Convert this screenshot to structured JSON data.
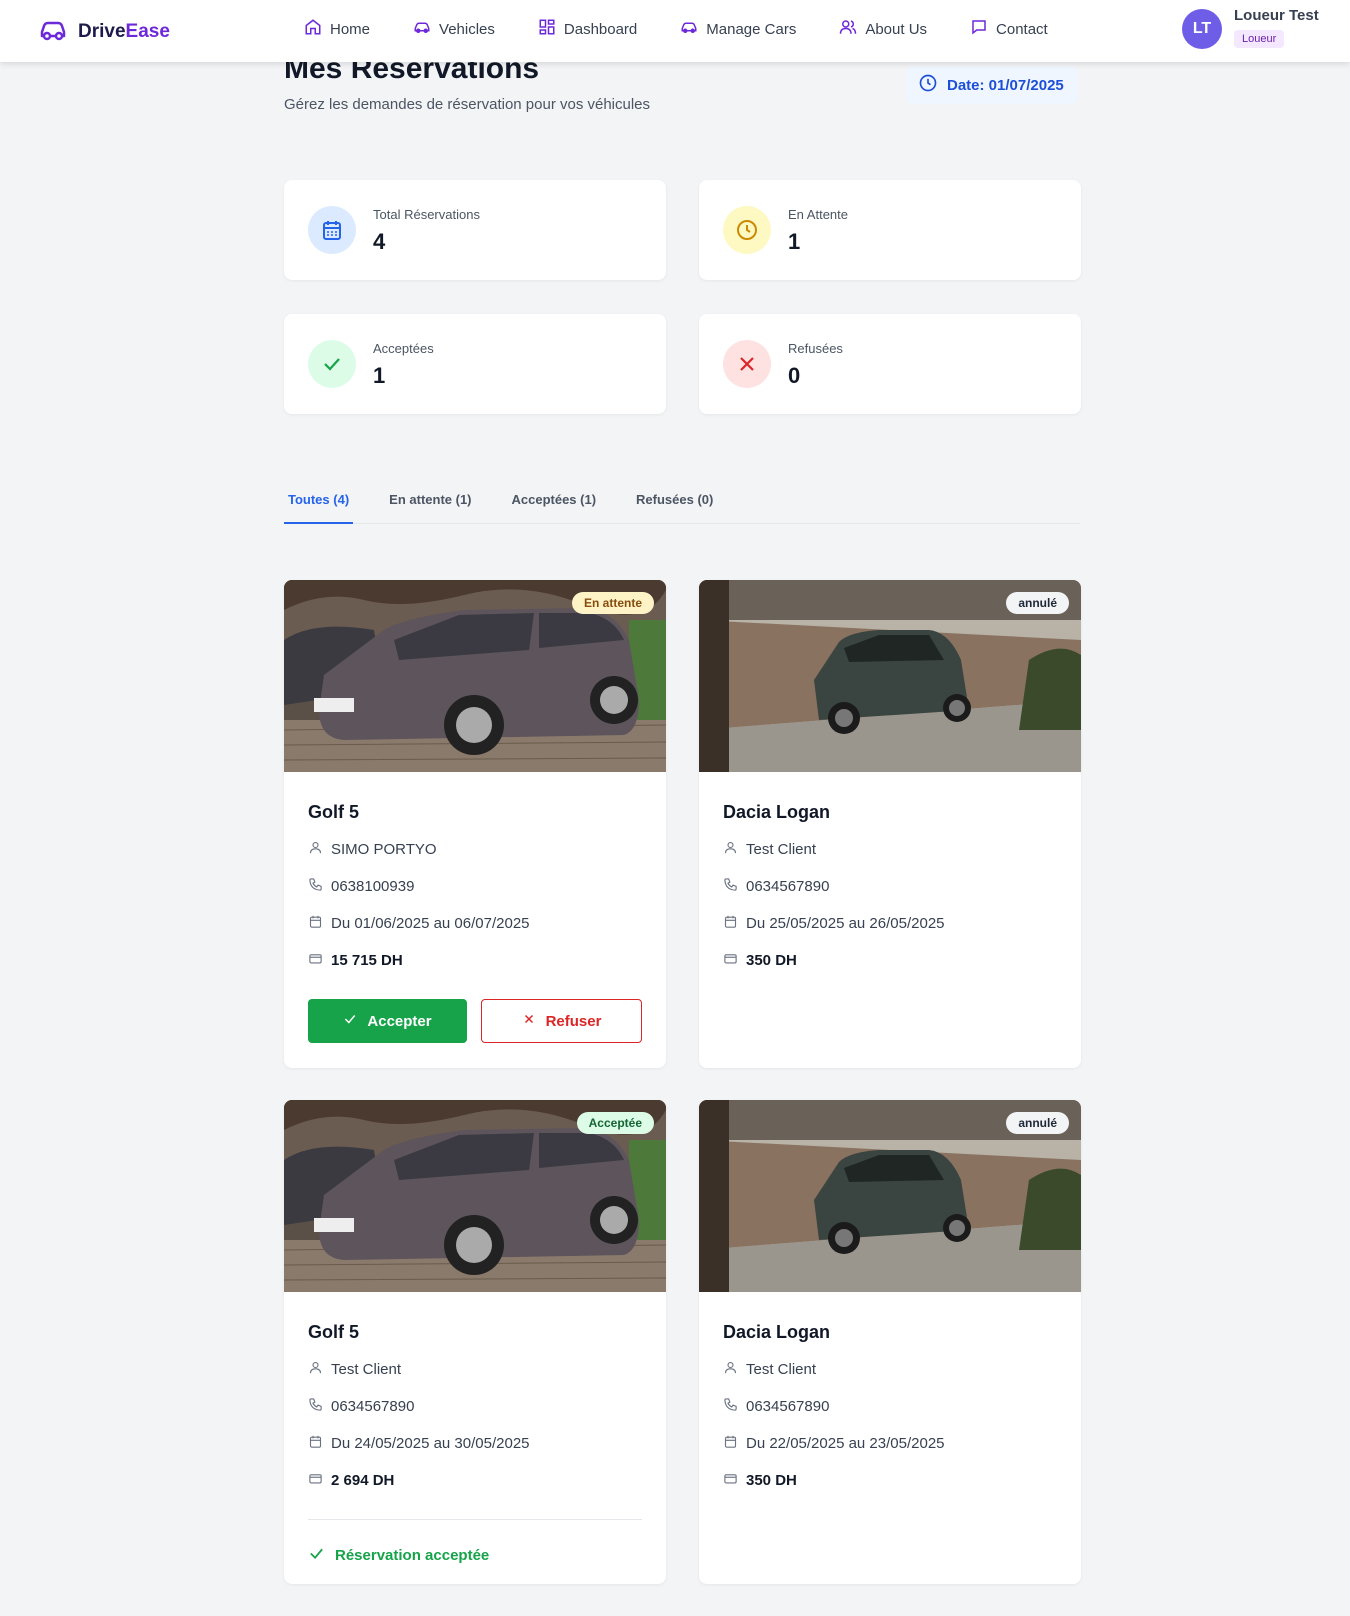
{
  "brand": {
    "part1": "Drive",
    "part2": "Ease",
    "icon": "car-icon"
  },
  "nav": [
    {
      "label": "Home",
      "icon": "home-icon"
    },
    {
      "label": "Vehicles",
      "icon": "car-icon"
    },
    {
      "label": "Dashboard",
      "icon": "dashboard-icon"
    },
    {
      "label": "Manage Cars",
      "icon": "car-icon"
    },
    {
      "label": "About Us",
      "icon": "users-icon"
    },
    {
      "label": "Contact",
      "icon": "message-icon"
    }
  ],
  "user": {
    "initials": "LT",
    "name": "Loueur Test",
    "role": "Loueur"
  },
  "header": {
    "title": "Mes Réservations",
    "subtitle": "Gérez les demandes de réservation pour vos véhicules",
    "date": "Date: 01/07/2025"
  },
  "stats": [
    {
      "label": "Total Réservations",
      "value": "4",
      "icon": "calendar-icon",
      "color": "#2563eb",
      "bg": "#dbeafe"
    },
    {
      "label": "En Attente",
      "value": "1",
      "icon": "clock-icon",
      "color": "#ca8a04",
      "bg": "#fef9c3"
    },
    {
      "label": "Acceptées",
      "value": "1",
      "icon": "check-icon",
      "color": "#16a34a",
      "bg": "#dcfce7"
    },
    {
      "label": "Refusées",
      "value": "0",
      "icon": "x-icon",
      "color": "#dc2626",
      "bg": "#fee2e2"
    }
  ],
  "tabs": [
    {
      "label": "Toutes (4)",
      "active": true
    },
    {
      "label": "En attente (1)",
      "active": false
    },
    {
      "label": "Acceptées (1)",
      "active": false
    },
    {
      "label": "Refusées (0)",
      "active": false
    }
  ],
  "reservations": [
    {
      "car": "Golf 5",
      "status": "En attente",
      "client": "SIMO PORTYO",
      "phone": "0638100939",
      "dates": "Du 01/06/2025 au 06/07/2025",
      "price": "15 715 DH"
    },
    {
      "car": "Dacia Logan",
      "status": "annulé",
      "client": "Test Client",
      "phone": "0634567890",
      "dates": "Du 25/05/2025 au 26/05/2025",
      "price": "350 DH"
    },
    {
      "car": "Golf 5",
      "status": "Acceptée",
      "client": "Test Client",
      "phone": "0634567890",
      "dates": "Du 24/05/2025 au 30/05/2025",
      "price": "2 694 DH"
    },
    {
      "car": "Dacia Logan",
      "status": "annulé",
      "client": "Test Client",
      "phone": "0634567890",
      "dates": "Du 22/05/2025 au 23/05/2025",
      "price": "350 DH"
    }
  ],
  "actions": {
    "accept": "Accepter",
    "refuse": "Refuser",
    "accepted_note": "Réservation acceptée"
  },
  "colors": {
    "accent": "#2563eb",
    "brand": "#6d28d9",
    "success": "#16a34a",
    "danger": "#dc2626"
  }
}
